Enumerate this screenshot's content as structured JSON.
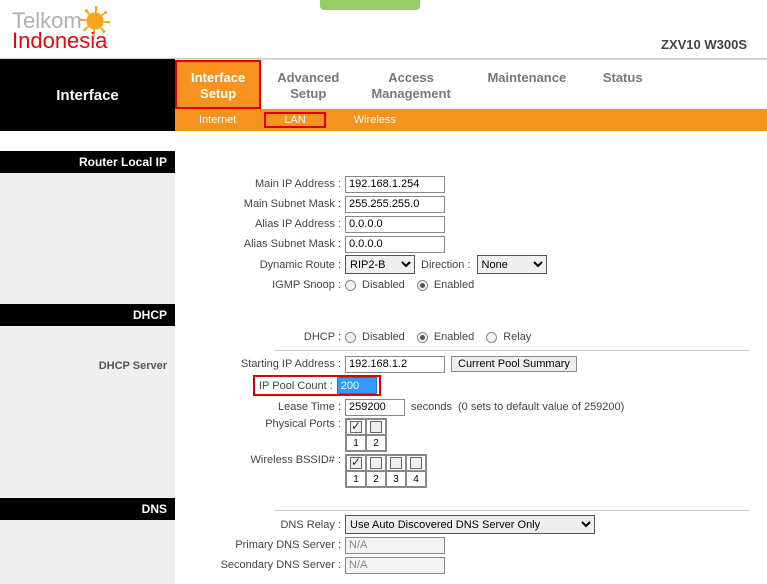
{
  "header": {
    "brand1": "Telkom",
    "brand2": "Indonesia",
    "model": "ZXV10 W300S"
  },
  "nav": {
    "pageTitle": "Interface",
    "tabs": [
      {
        "l1": "Interface",
        "l2": "Setup",
        "active": true
      },
      {
        "l1": "Advanced",
        "l2": "Setup"
      },
      {
        "l1": "Access",
        "l2": "Management"
      },
      {
        "l1": "Maintenance",
        "l2": ""
      },
      {
        "l1": "Status",
        "l2": ""
      }
    ],
    "subtabs": [
      "Internet",
      "LAN",
      "Wireless"
    ],
    "activeSub": "LAN"
  },
  "sections": {
    "routerLocalIp": "Router Local IP",
    "dhcp": "DHCP",
    "dhcpServer": "DHCP Server",
    "dns": "DNS"
  },
  "labels": {
    "mainIp": "Main IP Address :",
    "mainMask": "Main Subnet Mask :",
    "aliasIp": "Alias IP Address :",
    "aliasMask": "Alias Subnet Mask :",
    "dynRoute": "Dynamic Route :",
    "direction": "Direction :",
    "igmp": "IGMP Snoop :",
    "dhcp": "DHCP :",
    "startIp": "Starting IP Address :",
    "poolCount": "IP Pool Count :",
    "leaseTime": "Lease Time :",
    "physPorts": "Physical Ports :",
    "bssid": "Wireless BSSID# :",
    "dnsRelay": "DNS Relay :",
    "primaryDns": "Primary DNS Server :",
    "secondaryDns": "Secondary DNS Server :",
    "disabled": "Disabled",
    "enabled": "Enabled",
    "relay": "Relay",
    "seconds": "seconds",
    "leaseNote": "(0 sets to default value of 259200)",
    "poolBtn": "Current Pool Summary"
  },
  "values": {
    "mainIp": "192.168.1.254",
    "mainMask": "255.255.255.0",
    "aliasIp": "0.0.0.0",
    "aliasMask": "0.0.0.0",
    "dynRoute": "RIP2-B",
    "direction": "None",
    "igmp": "Enabled",
    "dhcpMode": "Enabled",
    "startIp": "192.168.1.2",
    "poolCount": "200",
    "leaseTime": "259200",
    "physPorts": [
      "1",
      "2"
    ],
    "physChecked": [
      true,
      false
    ],
    "bssidNums": [
      "1",
      "2",
      "3",
      "4"
    ],
    "bssidChecked": [
      true,
      false,
      false,
      false
    ],
    "dnsRelay": "Use Auto Discovered DNS Server Only",
    "primaryDns": "N/A",
    "secondaryDns": "N/A"
  }
}
